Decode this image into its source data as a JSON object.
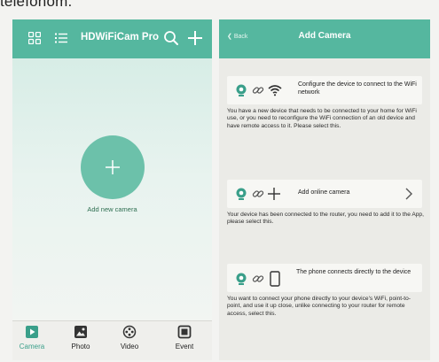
{
  "caption": "telefonom.",
  "left_screen": {
    "app_title": "HDWiFiCam Pro",
    "header_icons": [
      "grid-icon",
      "list-icon",
      "search-icon",
      "plus-icon"
    ],
    "add_label": "Add new camera",
    "nav": [
      {
        "label": "Camera",
        "icon": "camera-play-icon",
        "active": true
      },
      {
        "label": "Photo",
        "icon": "photo-icon",
        "active": false
      },
      {
        "label": "Video",
        "icon": "video-reel-icon",
        "active": false
      },
      {
        "label": "Event",
        "icon": "event-icon",
        "active": false
      }
    ]
  },
  "right_screen": {
    "back_label": "Back",
    "title": "Add Camera",
    "options": [
      {
        "label": "Configure the device to connect to the WiFi network",
        "description": "You have a new device that needs to be connected to your home for WiFi use, or you need to reconfigure the WiFi connection of an old device and have remote access to it. Please select this.",
        "icons": [
          "camera-icon",
          "link-icon",
          "wifi-icon"
        ]
      },
      {
        "label": "Add online camera",
        "description": "Your device has been connected to the router, you need to add it to the App, please select this.",
        "icons": [
          "camera-icon",
          "link-icon",
          "plus-icon"
        ]
      },
      {
        "label": "The phone connects directly to the device",
        "description": "You want to connect your phone directly to your device's WiFi, point-to-point, and use it up close, unlike connecting to your router for remote access, select this.",
        "icons": [
          "camera-icon",
          "link-icon",
          "phone-icon"
        ]
      }
    ]
  },
  "colors": {
    "header": "#55b79f",
    "accent": "#3a9f8a",
    "add_circle": "#6cc1aa"
  }
}
